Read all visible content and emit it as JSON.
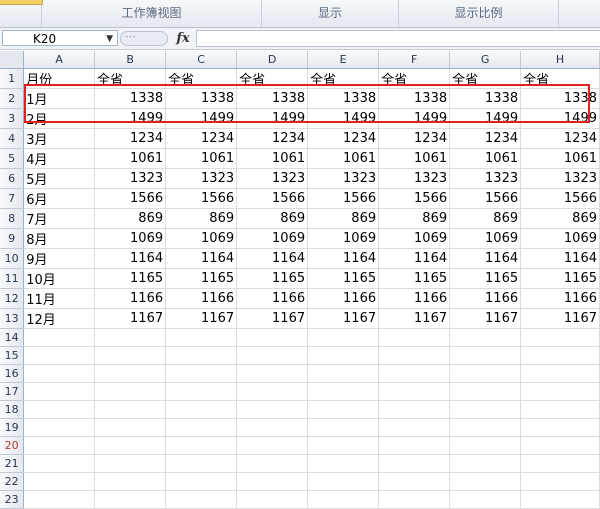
{
  "ribbon": {
    "groups": [
      "",
      "工作簿视图",
      "显示",
      "显示比例"
    ]
  },
  "formula_bar": {
    "name_box": "K20",
    "name_box_arrow": "▼",
    "fx_label": "fx",
    "dots": "⋯",
    "formula": ""
  },
  "sheet": {
    "columns": [
      "A",
      "B",
      "C",
      "D",
      "E",
      "F",
      "G",
      "H"
    ],
    "row_numbers": [
      "1",
      "2",
      "3",
      "4",
      "5",
      "6",
      "7",
      "8",
      "9",
      "10",
      "11",
      "12",
      "13",
      "14",
      "15",
      "16",
      "17",
      "18",
      "19",
      "20",
      "21",
      "22",
      "23"
    ],
    "active_row": "20",
    "rows": [
      [
        "月份",
        "全省",
        "全省",
        "全省",
        "全省",
        "全省",
        "全省",
        "全省"
      ],
      [
        "1月",
        "1338",
        "1338",
        "1338",
        "1338",
        "1338",
        "1338",
        "1338"
      ],
      [
        "2月",
        "1499",
        "1499",
        "1499",
        "1499",
        "1499",
        "1499",
        "1499"
      ],
      [
        "3月",
        "1234",
        "1234",
        "1234",
        "1234",
        "1234",
        "1234",
        "1234"
      ],
      [
        "4月",
        "1061",
        "1061",
        "1061",
        "1061",
        "1061",
        "1061",
        "1061"
      ],
      [
        "5月",
        "1323",
        "1323",
        "1323",
        "1323",
        "1323",
        "1323",
        "1323"
      ],
      [
        "6月",
        "1566",
        "1566",
        "1566",
        "1566",
        "1566",
        "1566",
        "1566"
      ],
      [
        "7月",
        "869",
        "869",
        "869",
        "869",
        "869",
        "869",
        "869"
      ],
      [
        "8月",
        "1069",
        "1069",
        "1069",
        "1069",
        "1069",
        "1069",
        "1069"
      ],
      [
        "9月",
        "1164",
        "1164",
        "1164",
        "1164",
        "1164",
        "1164",
        "1164"
      ],
      [
        "10月",
        "1165",
        "1165",
        "1165",
        "1165",
        "1165",
        "1165",
        "1165"
      ],
      [
        "11月",
        "1166",
        "1166",
        "1166",
        "1166",
        "1166",
        "1166",
        "1166"
      ],
      [
        "12月",
        "1167",
        "1167",
        "1167",
        "1167",
        "1167",
        "1167",
        "1167"
      ]
    ]
  },
  "colors": {
    "highlight_box": "#e0211c",
    "active_row_header": "#c0392b"
  }
}
